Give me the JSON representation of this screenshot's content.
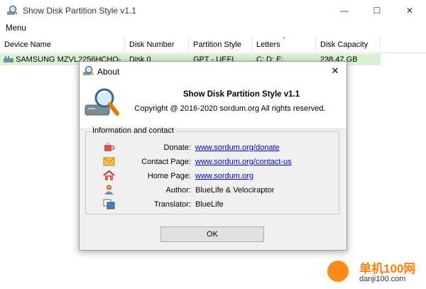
{
  "window": {
    "title": "Show Disk Partition Style v1.1",
    "controls": {
      "minimize": "—",
      "maximize": "☐",
      "close": "✕"
    }
  },
  "menu": {
    "items": [
      "Menu"
    ]
  },
  "list": {
    "columns": [
      "Device Name",
      "Disk Number",
      "Partition Style",
      "Letters",
      "Disk Capacity"
    ],
    "sort_indicator": "^",
    "rows": [
      {
        "device": "SAMSUNG MZVL2256HCHO-...",
        "disk": "Disk 0",
        "style": "GPT - UEFI",
        "letters": "C:  D:  E:",
        "capacity": "238.47 GB"
      }
    ]
  },
  "about": {
    "title": "About",
    "close": "✕",
    "app_name": "Show Disk Partition Style v1.1",
    "copyright": "Copyright @ 2016-2020 sordum.org All rights reserved.",
    "group_label": "Information and contact",
    "items": [
      {
        "label": "Donate:",
        "value": "www.sordum.org/donate",
        "icon": "coffee-icon"
      },
      {
        "label": "Contact Page:",
        "value": "www.sordum.org/contact-us",
        "icon": "envelope-icon"
      },
      {
        "label": "Home Page:",
        "value": "www.sordum.org",
        "icon": "home-icon"
      },
      {
        "label": "Author:",
        "value": "BlueLife & Velociraptor",
        "icon": "author-icon"
      },
      {
        "label": "Translator:",
        "value": "BlueLife",
        "icon": "translate-icon"
      }
    ],
    "ok": "OK"
  },
  "watermark": {
    "line1": "单机100网",
    "line2": "danji100.com"
  },
  "colors": {
    "row_highlight": "#d9f3d2",
    "link": "#0000cc",
    "dialog_bg": "#f0f0f0"
  }
}
